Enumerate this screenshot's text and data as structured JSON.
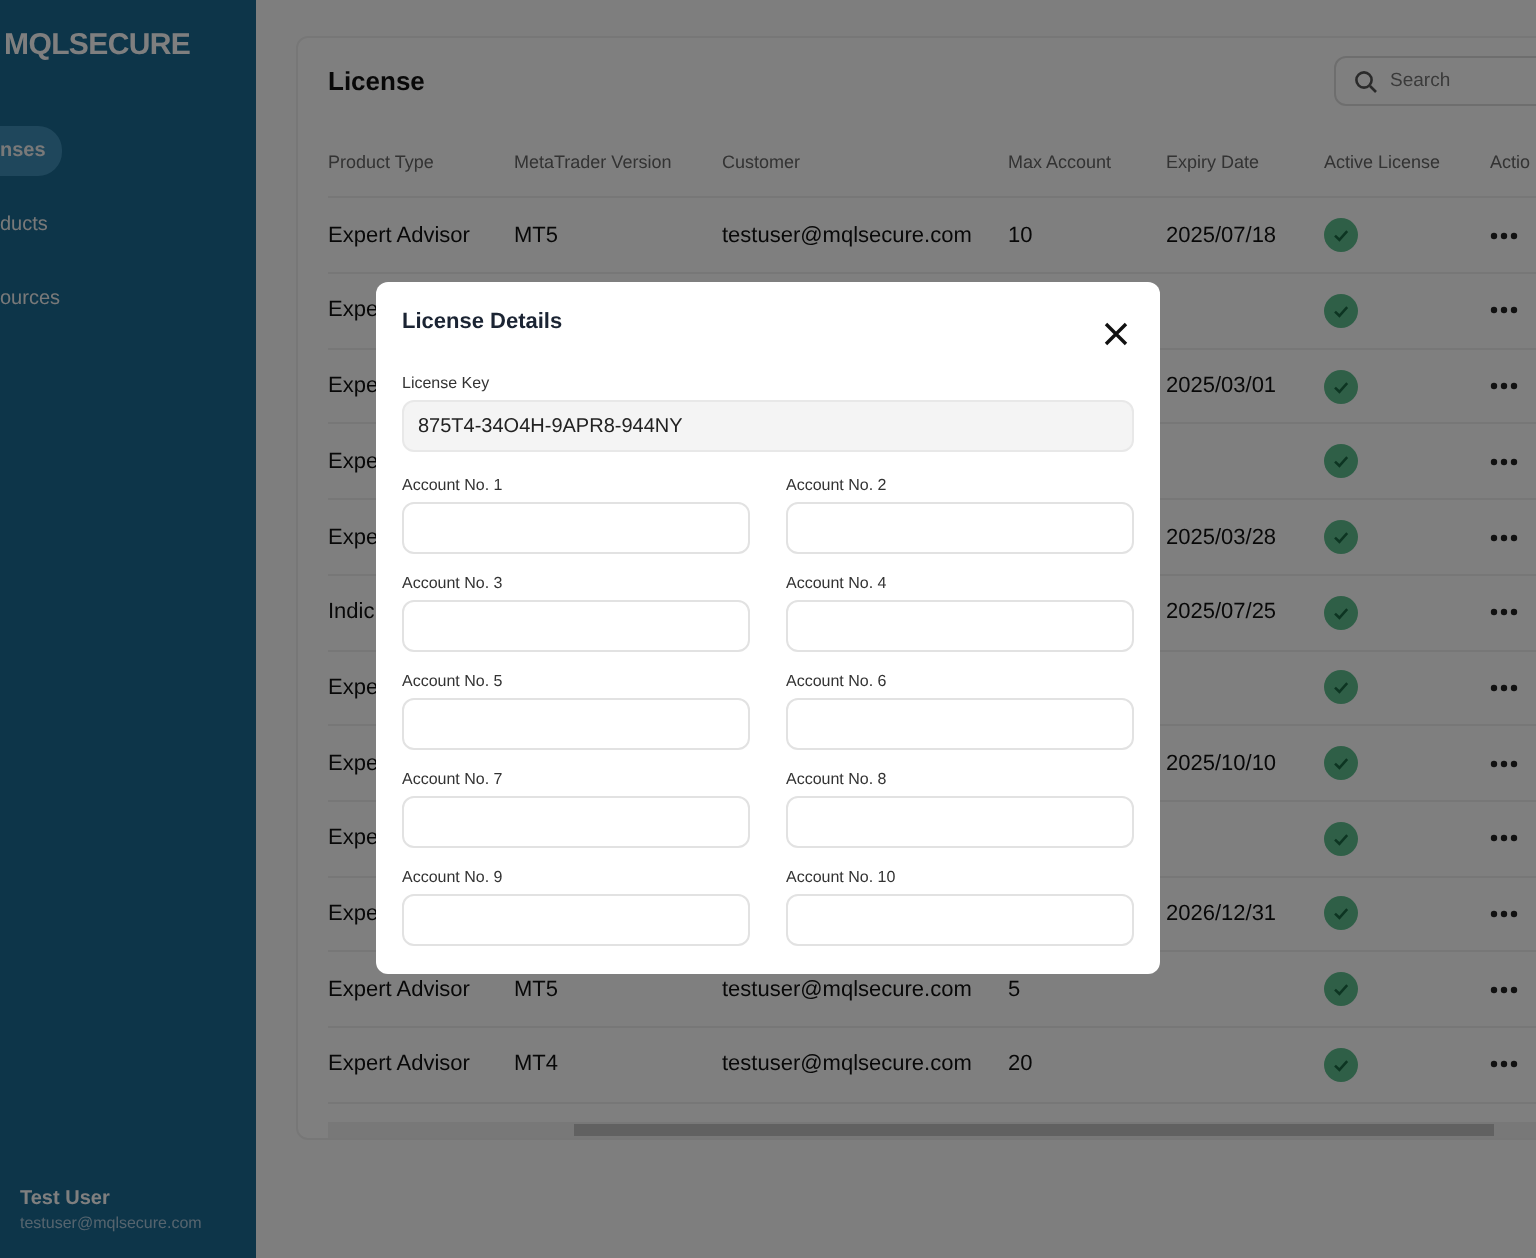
{
  "sidebar": {
    "logo": "MQLSECURE",
    "items": [
      {
        "label": "nses",
        "selected": true
      },
      {
        "label": "ducts",
        "selected": false
      },
      {
        "label": "ources",
        "selected": false
      }
    ],
    "user": {
      "name": "Test User",
      "email": "testuser@mqlsecure.com"
    }
  },
  "page": {
    "title": "License",
    "search": {
      "placeholder": "Search"
    }
  },
  "table": {
    "columns": [
      "Product Type",
      "MetaTrader Version",
      "Customer",
      "Max Account",
      "Expiry Date",
      "Active License",
      "Actio"
    ],
    "rows": [
      {
        "product": "Expert Advisor",
        "version": "MT5",
        "customer": "testuser@mqlsecure.com",
        "max": "10",
        "expiry": "2025/07/18",
        "active": true
      },
      {
        "product": "Expe",
        "active": true
      },
      {
        "product": "Expe",
        "expiry": "2025/03/01",
        "active": true
      },
      {
        "product": "Expe",
        "active": true
      },
      {
        "product": "Expe",
        "expiry": "2025/03/28",
        "active": true
      },
      {
        "product": "Indic",
        "expiry": "2025/07/25",
        "active": true
      },
      {
        "product": "Expe",
        "active": true
      },
      {
        "product": "Expe",
        "expiry": "2025/10/10",
        "active": true
      },
      {
        "product": "Expe",
        "active": true
      },
      {
        "product": "Expe",
        "expiry": "2026/12/31",
        "active": true
      },
      {
        "product": "Expert Advisor",
        "version": "MT5",
        "customer": "testuser@mqlsecure.com",
        "max": "5",
        "active": true
      },
      {
        "product": "Expert Advisor",
        "version": "MT4",
        "customer": "testuser@mqlsecure.com",
        "max": "20",
        "active": true
      }
    ]
  },
  "dialog": {
    "title": "License Details",
    "key_label": "License Key",
    "key_value": "875T4-34O4H-9APR8-944NY",
    "accounts": [
      "Account No. 1",
      "Account No. 2",
      "Account No. 3",
      "Account No. 4",
      "Account No. 5",
      "Account No. 6",
      "Account No. 7",
      "Account No. 8",
      "Account No. 9",
      "Account No. 10"
    ]
  }
}
